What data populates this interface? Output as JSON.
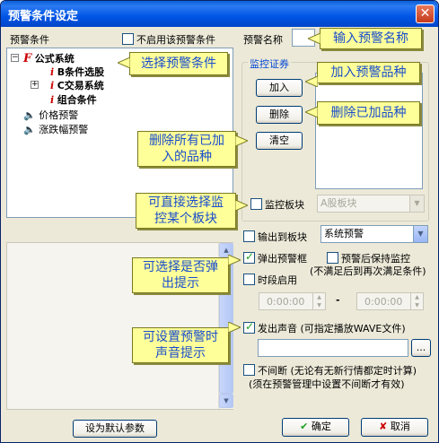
{
  "window": {
    "title": "预警条件设定",
    "close_icon": "close-icon"
  },
  "left": {
    "conditions_label": "预警条件",
    "disable_label": "不启用该预警条件",
    "tree": {
      "root_label": "公式系统",
      "items": [
        "B条件选股",
        "C交易系统",
        "组合条件"
      ],
      "extra": [
        "价格预警",
        "涨跌幅预警"
      ]
    },
    "default_button": "设为默认参数"
  },
  "right": {
    "name_label": "预警名称",
    "name_value": "",
    "group_label": "监控证券",
    "add_button": "加入",
    "delete_button": "删除",
    "clear_button": "清空",
    "block_label": "监控板块",
    "block_value": "A股板块",
    "output_label": "输出到板块",
    "output_value": "系统预警",
    "popup_label": "弹出预警框",
    "keep_label": "预警后保持监控",
    "keep_note": "(不满足后到再次满足条件)",
    "period_label": "时段启用",
    "time_start": "0:00:00",
    "time_dash": "-",
    "time_end": "0:00:00",
    "sound_label": "发出声音 (可指定播放WAVE文件)",
    "browse_button": "...",
    "continuous_label": "不间断 (无论有无新行情都定时计算)",
    "continuous_note": "(须在预警管理中设置不间断才有效)",
    "ok_button": "确定",
    "cancel_button": "取消"
  },
  "checkboxes": {
    "disable": false,
    "block": false,
    "output": false,
    "popup": true,
    "keep": false,
    "period": false,
    "sound": true,
    "continuous": false
  },
  "callouts": {
    "name": "输入预警名称",
    "select_condition": "选择预警条件",
    "add_stock": "加入预警品种",
    "delete_stock": "删除已加品种",
    "delete_all": "删除所有已加\n入的品种",
    "select_block": "可直接选择监\n控某个板块",
    "popup_hint": "可选择是否弹\n出提示",
    "sound_hint": "可设置预警时\n声音提示"
  },
  "colors": {
    "title_bar": "#0055e5",
    "callout_bg": "#ffff99",
    "callout_text": "#1a4dcc",
    "dialog_bg": "#ece9d8"
  }
}
